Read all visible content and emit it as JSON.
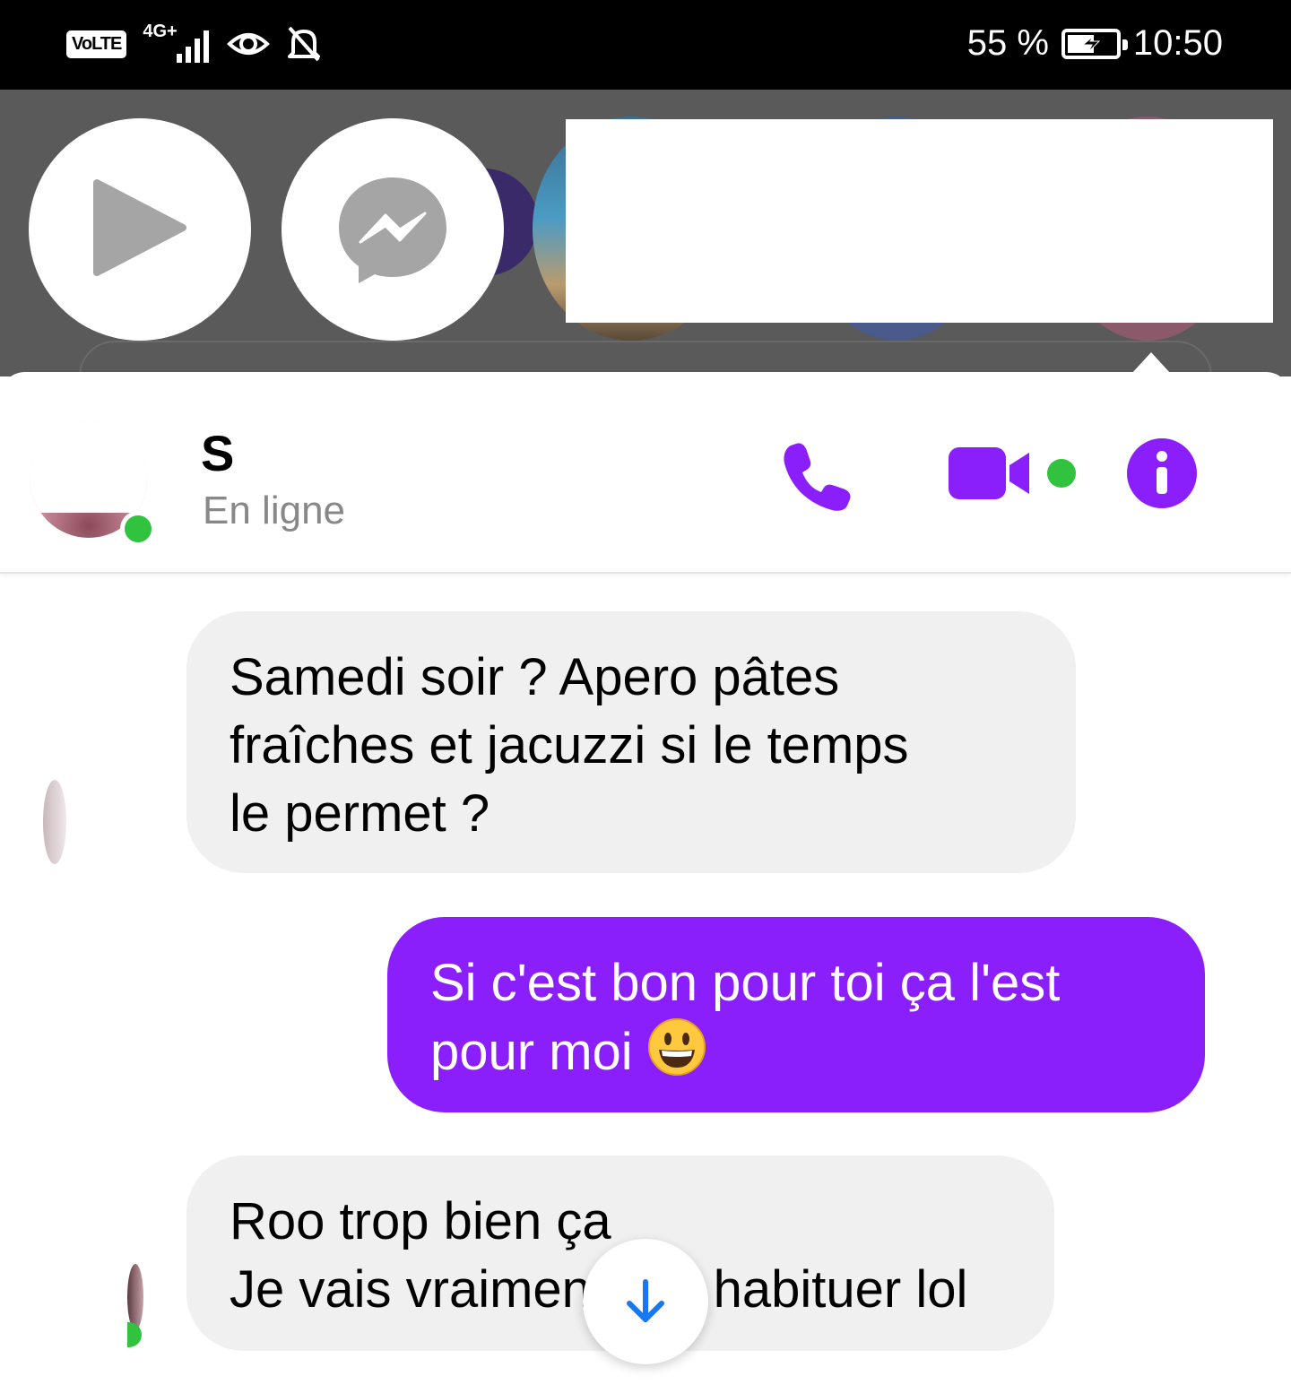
{
  "status_bar": {
    "volte": "VoLTE",
    "network": "4G+",
    "battery_text": "55 %",
    "battery_level": 0.55,
    "time": "10:50",
    "icons": [
      "eye-icon",
      "bell-off-icon",
      "battery-charging-icon"
    ]
  },
  "chat_heads": {
    "items": [
      "play-icon",
      "messenger-icon"
    ]
  },
  "conversation": {
    "contact_name": "S",
    "contact_status": "En ligne",
    "accent_color": "#8a1ffb",
    "online_color": "#31c23f",
    "header_actions": [
      "phone-icon",
      "video-call-icon",
      "info-icon"
    ]
  },
  "messages": [
    {
      "direction": "incoming",
      "lines": [
        "Samedi soir ? Apero pâtes",
        "fraîches et jacuzzi si le temps",
        "le permet ?"
      ]
    },
    {
      "direction": "outgoing",
      "lines": [
        "Si c'est bon pour toi ça l'est",
        "pour moi"
      ],
      "emoji": "grinning-face"
    },
    {
      "direction": "incoming",
      "lines": [
        "Roo trop bien ça",
        "Je vais vraiment m'y habituer lol"
      ]
    }
  ],
  "scroll_button": {
    "icon": "arrow-down-icon"
  }
}
